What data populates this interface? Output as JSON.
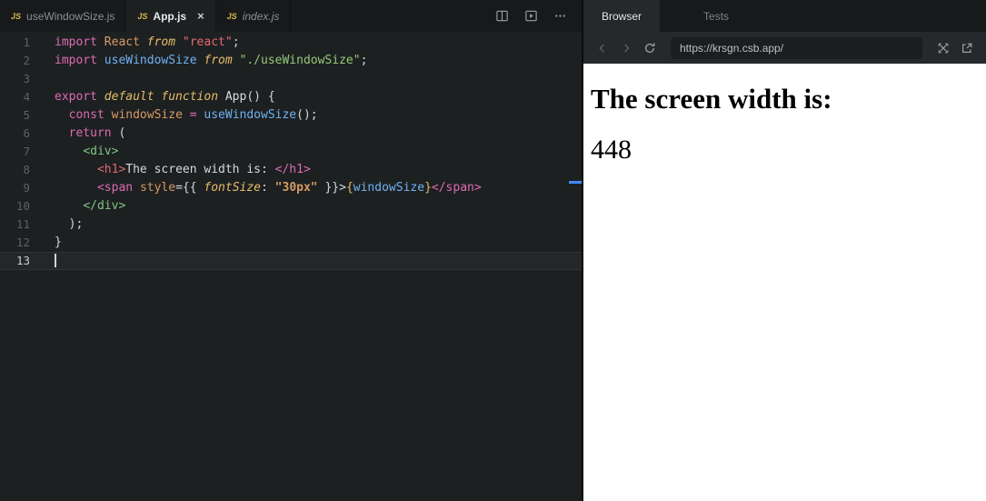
{
  "theme": {
    "accent_blue": "#3f8cf3",
    "editor_background": "#1d2021",
    "panel_background": "#26282b",
    "tabbar_background": "#17191a"
  },
  "editor": {
    "tabs": [
      {
        "label": "useWindowSize.js",
        "icon": "JS",
        "active": false,
        "preview": false,
        "close": ""
      },
      {
        "label": "App.js",
        "icon": "JS",
        "active": true,
        "preview": false,
        "close": "×"
      },
      {
        "label": "index.js",
        "icon": "JS",
        "active": false,
        "preview": true,
        "close": ""
      }
    ],
    "lines": [
      {
        "n": "1",
        "toks": [
          {
            "c": "kw",
            "t": "import"
          },
          {
            "c": "fg",
            "t": " "
          },
          {
            "c": "var",
            "t": "React"
          },
          {
            "c": "kw2",
            "t": " from "
          },
          {
            "c": "str",
            "t": "\"react\""
          },
          {
            "c": "fg",
            "t": ";"
          }
        ]
      },
      {
        "n": "2",
        "toks": [
          {
            "c": "kw",
            "t": "import"
          },
          {
            "c": "fg",
            "t": " "
          },
          {
            "c": "fn",
            "t": "useWindowSize"
          },
          {
            "c": "kw2",
            "t": " from "
          },
          {
            "c": "strg",
            "t": "\"./useWindowSize\""
          },
          {
            "c": "fg",
            "t": ";"
          }
        ]
      },
      {
        "n": "3",
        "toks": []
      },
      {
        "n": "4",
        "toks": [
          {
            "c": "kw",
            "t": "export"
          },
          {
            "c": "kw2",
            "t": " default function "
          },
          {
            "c": "cmp",
            "t": "App"
          },
          {
            "c": "fg",
            "t": "() {"
          }
        ]
      },
      {
        "n": "5",
        "toks": [
          {
            "c": "fg",
            "t": "  "
          },
          {
            "c": "kw",
            "t": "const"
          },
          {
            "c": "fg",
            "t": " "
          },
          {
            "c": "var",
            "t": "windowSize"
          },
          {
            "c": "op",
            "t": " = "
          },
          {
            "c": "fn",
            "t": "useWindowSize"
          },
          {
            "c": "fg",
            "t": "();"
          }
        ]
      },
      {
        "n": "6",
        "toks": [
          {
            "c": "fg",
            "t": "  "
          },
          {
            "c": "kw",
            "t": "return"
          },
          {
            "c": "fg",
            "t": " ("
          }
        ]
      },
      {
        "n": "7",
        "toks": [
          {
            "c": "fg",
            "t": "    "
          },
          {
            "c": "tagg",
            "t": "<div>"
          }
        ]
      },
      {
        "n": "8",
        "toks": [
          {
            "c": "fg",
            "t": "      "
          },
          {
            "c": "tagr",
            "t": "<h1>"
          },
          {
            "c": "fg",
            "t": "The screen width is: "
          },
          {
            "c": "tagp",
            "t": "</h1>"
          }
        ]
      },
      {
        "n": "9",
        "toks": [
          {
            "c": "fg",
            "t": "      "
          },
          {
            "c": "tagp",
            "t": "<span "
          },
          {
            "c": "var",
            "t": "style"
          },
          {
            "c": "fg",
            "t": "={{ "
          },
          {
            "c": "kw2",
            "t": "fontSize"
          },
          {
            "c": "fg",
            "t": ": "
          },
          {
            "c": "strb",
            "t": "\"30px\""
          },
          {
            "c": "fg",
            "t": " }}>"
          },
          {
            "c": "brace",
            "t": "{"
          },
          {
            "c": "fn",
            "t": "windowSize"
          },
          {
            "c": "brace",
            "t": "}"
          },
          {
            "c": "tagp",
            "t": "</span>"
          }
        ]
      },
      {
        "n": "10",
        "toks": [
          {
            "c": "fg",
            "t": "    "
          },
          {
            "c": "tagg",
            "t": "</div>"
          }
        ]
      },
      {
        "n": "11",
        "toks": [
          {
            "c": "fg",
            "t": "  );"
          }
        ]
      },
      {
        "n": "12",
        "toks": [
          {
            "c": "fg",
            "t": "}"
          }
        ]
      },
      {
        "n": "13",
        "toks": [],
        "current": true,
        "cursor": true
      }
    ]
  },
  "browser": {
    "tabs": [
      {
        "label": "Browser",
        "active": true
      },
      {
        "label": "Tests",
        "active": false
      }
    ],
    "url": "https://krsgn.csb.app/",
    "content": {
      "heading": "The screen width is:",
      "width_value": "448"
    }
  }
}
